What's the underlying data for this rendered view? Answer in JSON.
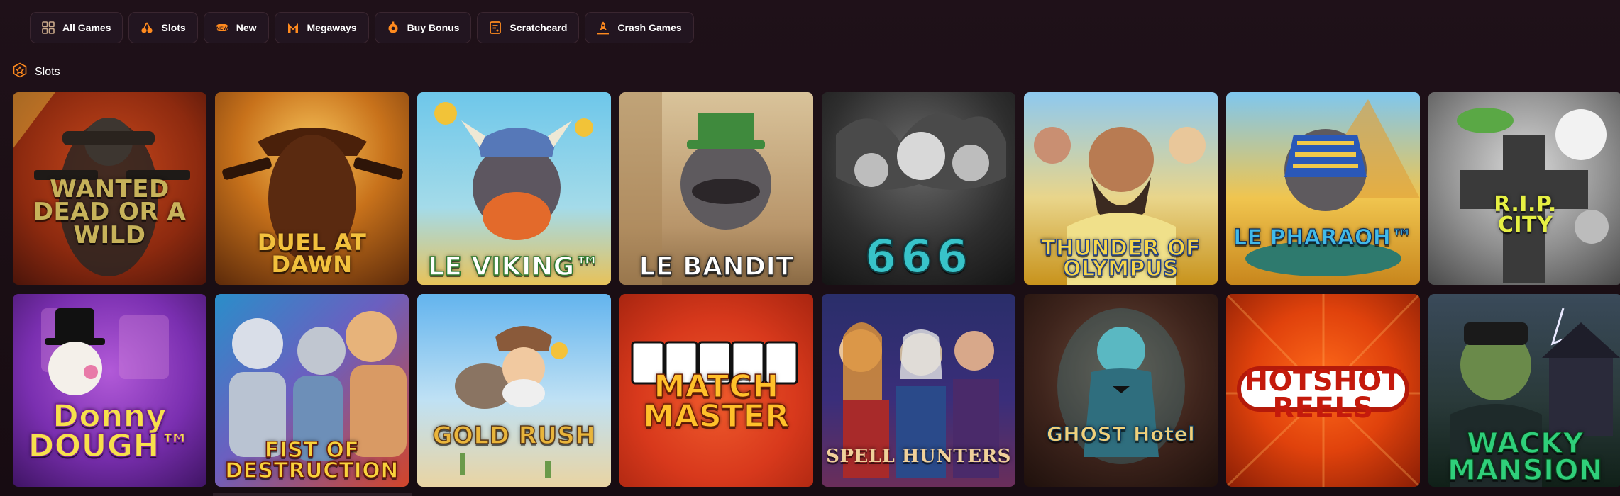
{
  "categories": [
    {
      "label": "All Games",
      "icon": "grid-icon"
    },
    {
      "label": "Slots",
      "icon": "cherry-icon"
    },
    {
      "label": "New",
      "icon": "new-badge-icon"
    },
    {
      "label": "Megaways",
      "icon": "megaways-icon"
    },
    {
      "label": "Buy Bonus",
      "icon": "bonus-icon"
    },
    {
      "label": "Scratchcard",
      "icon": "scratchcard-icon"
    },
    {
      "label": "Crash Games",
      "icon": "rocket-icon"
    }
  ],
  "section": {
    "title": "Slots",
    "icon": "slots-badge-icon"
  },
  "accent_color": "#ff8a1e",
  "games": [
    {
      "title": "Wanted Dead or a Wild"
    },
    {
      "title": "Duel at Dawn"
    },
    {
      "title": "Le Viking"
    },
    {
      "title": "Le Bandit"
    },
    {
      "title": "666"
    },
    {
      "title": "Thunder of Olympus"
    },
    {
      "title": "Le Pharaoh"
    },
    {
      "title": "R.I.P. City"
    },
    {
      "title": "Donny Dough"
    },
    {
      "title": "Fist of Destruction"
    },
    {
      "title": "Gold Rush"
    },
    {
      "title": "Match Master"
    },
    {
      "title": "Spell Hunters"
    },
    {
      "title": "Ghost Hotel"
    },
    {
      "title": "Hotshot Reels"
    },
    {
      "title": "Wacky Mansion"
    }
  ],
  "tile_logos": [
    "WANTED\nDEAD OR A WILD",
    "DUEL AT DAWN",
    "LE VIKING™",
    "LE BANDIT",
    "666",
    "THUNDER OF\nOLYMPUS",
    "LE PHARAOH™",
    "R.I.P.\nCITY",
    "Donny\nDOUGH™",
    "FIST OF\nDESTRUCTION",
    "GOLD RUSH",
    "MATCH\nMASTER",
    "SPELL HUNTERS",
    "GHOST Hotel",
    "HOTSHOT\nREELS",
    "WACKY\nMANSION"
  ]
}
